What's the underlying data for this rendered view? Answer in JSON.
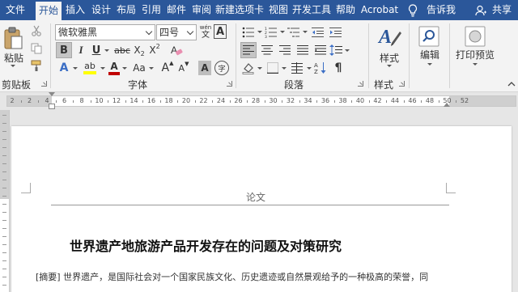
{
  "tabs": [
    {
      "label": "文件"
    },
    {
      "label": "开始"
    },
    {
      "label": "插入"
    },
    {
      "label": "设计"
    },
    {
      "label": "布局"
    },
    {
      "label": "引用"
    },
    {
      "label": "邮件"
    },
    {
      "label": "审阅"
    },
    {
      "label": "新建选项卡"
    },
    {
      "label": "视图"
    },
    {
      "label": "开发工具"
    },
    {
      "label": "帮助"
    },
    {
      "label": "Acrobat"
    }
  ],
  "tell_me": "告诉我",
  "share": "共享",
  "clipboard": {
    "paste_label": "粘贴",
    "group_label": "剪贴板",
    "icons": [
      "cut-icon",
      "copy-icon",
      "format-painter-icon"
    ]
  },
  "font": {
    "font_name": "微软雅黑",
    "font_size": "四号",
    "wen_top": "wén",
    "wen_bottom": "文",
    "border_char": "A",
    "bold": "B",
    "italic": "I",
    "underline": "U",
    "strikethrough": "abc",
    "subscript": "X",
    "superscript": "X",
    "sub_mark": "2",
    "sup_mark": "2",
    "text_effects": "A",
    "highlight": "ab",
    "font_color": "A",
    "change_case": "Aa",
    "grow_font": "A",
    "shrink_font": "A",
    "char_shading": "A",
    "enclose_char": "字",
    "group_label": "字体",
    "highlight_color": "#ffff00",
    "font_color_value": "#c00000"
  },
  "paragraph": {
    "group_label": "段落",
    "icons": [
      "bullets-icon",
      "numbering-icon",
      "multilevel-list-icon",
      "decrease-indent-icon",
      "increase-indent-icon",
      "align-left-icon",
      "center-icon",
      "align-right-icon",
      "justify-icon",
      "distributed-icon",
      "line-spacing-icon",
      "shading-icon",
      "borders-icon",
      "sort-icon",
      "show-marks-icon"
    ]
  },
  "styles": {
    "label": "样式",
    "group_label": "样式"
  },
  "editing": {
    "label": "编辑"
  },
  "print_preview": {
    "label": "打印预览"
  },
  "ruler": {
    "numbers": [
      "2",
      "2",
      "4",
      "6",
      "8",
      "10",
      "12",
      "14",
      "16",
      "18",
      "20",
      "22",
      "24",
      "26",
      "28",
      "30",
      "32",
      "34",
      "36",
      "38",
      "40",
      "42",
      "44",
      "46",
      "48",
      "50",
      "52"
    ]
  },
  "document": {
    "header": "论文",
    "title": "世界遗产地旅游产品开发存在的问题及对策研究",
    "abstract": "[摘要]  世界遗产，是国际社会对一个国家民族文化、历史遗迹或自然景观给予的一种极高的荣誉，同"
  },
  "colors": {
    "accent": "#2b579a",
    "ribbon_bg": "#f3f3f3"
  }
}
